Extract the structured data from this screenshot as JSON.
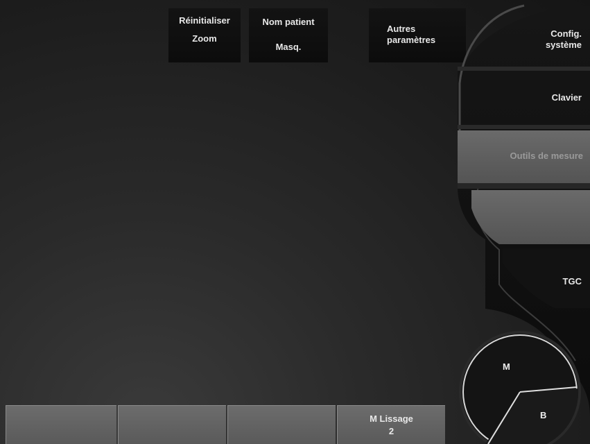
{
  "top_buttons": {
    "reset_zoom": {
      "line1": "Réinitialiser",
      "line2": "Zoom"
    },
    "patient_name": {
      "line1": "Nom patient",
      "line2": "Masq."
    },
    "other_params": {
      "line1": "Autres",
      "line2": "paramètres"
    }
  },
  "side_buttons": {
    "system_config": {
      "line1": "Config.",
      "line2": "système"
    },
    "keyboard": "Clavier",
    "measure_tools": "Outils de mesure",
    "empty": "",
    "tgc": "TGC"
  },
  "bottom_buttons": [
    {
      "label": "",
      "value": ""
    },
    {
      "label": "",
      "value": ""
    },
    {
      "label": "",
      "value": ""
    },
    {
      "label": "M Lissage",
      "value": "2"
    }
  ],
  "mode_dial": {
    "m_label": "M",
    "b_label": "B"
  },
  "colors": {
    "background": "#1d1d1d",
    "panel_dark": "#0c0c0c",
    "button_active": "#5e5e5e",
    "text": "#e8e8e8",
    "text_disabled": "#9a9a9a"
  }
}
